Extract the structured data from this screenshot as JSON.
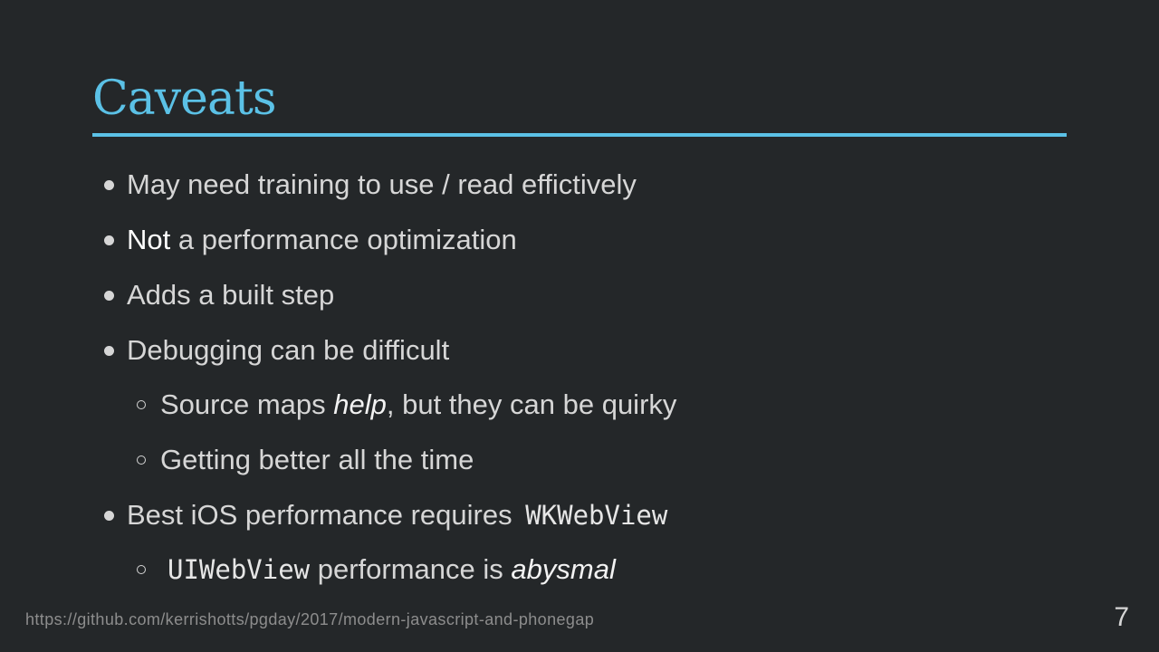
{
  "slide": {
    "title": "Caveats",
    "accent_color": "#5bc1e6",
    "background_color": "#242729",
    "bullets": [
      {
        "text": "May need training to use / read effictively"
      },
      {
        "strong": "Not",
        "rest": " a performance optimization"
      },
      {
        "text": "Adds a built step"
      },
      {
        "text": "Debugging can be difficult"
      },
      {
        "before": "Source maps ",
        "em": "help",
        "after": ", but they can be quirky"
      },
      {
        "text": "Getting better all the time"
      },
      {
        "before": "Best iOS performance requires ",
        "code": "WKWebView"
      },
      {
        "code": "UIWebView",
        "middle": " performance is ",
        "em": "abysmal"
      }
    ],
    "footer_url": "https://github.com/kerrishotts/pgday/2017/modern-javascript-and-phonegap",
    "page_number": "7"
  }
}
